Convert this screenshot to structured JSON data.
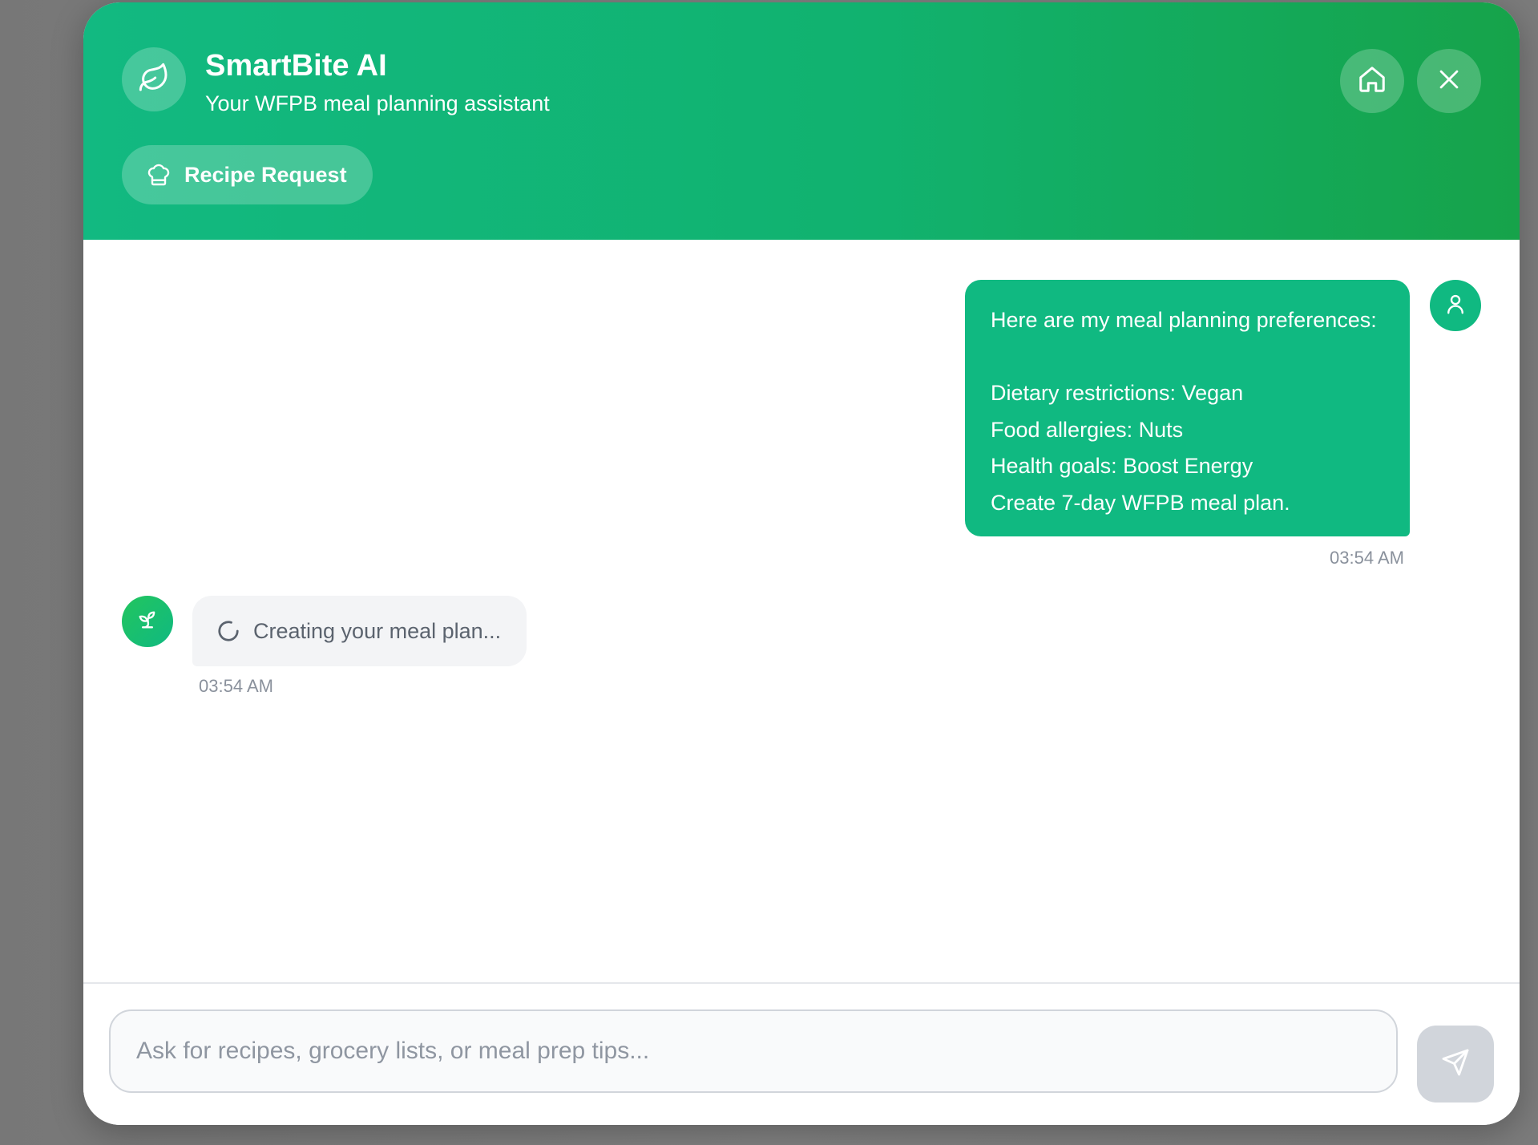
{
  "colors": {
    "brand_green": "#10b981",
    "header_gradient_end": "#16a34a",
    "bot_bubble_bg": "#f3f4f6",
    "send_button_disabled": "#d1d5db"
  },
  "header": {
    "icon": "leaf-icon",
    "title": "SmartBite AI",
    "subtitle": "Your WFPB meal planning assistant",
    "home_button_icon": "home-icon",
    "close_button_icon": "close-icon",
    "recipe_request": {
      "icon": "chef-hat-icon",
      "label": "Recipe Request"
    }
  },
  "messages": {
    "user": {
      "avatar_icon": "user-icon",
      "lines": [
        "Here are my meal planning preferences:",
        "",
        "Dietary restrictions: Vegan",
        "Food allergies: Nuts",
        "Health goals: Boost Energy",
        "Create 7-day WFPB meal plan."
      ],
      "time": "03:54 AM"
    },
    "bot": {
      "avatar_icon": "sprout-icon",
      "spinner_icon": "loading-spinner-icon",
      "text": "Creating your meal plan...",
      "time": "03:54 AM"
    }
  },
  "composer": {
    "placeholder": "Ask for recipes, grocery lists, or meal prep tips...",
    "value": "",
    "send_icon": "send-icon"
  }
}
